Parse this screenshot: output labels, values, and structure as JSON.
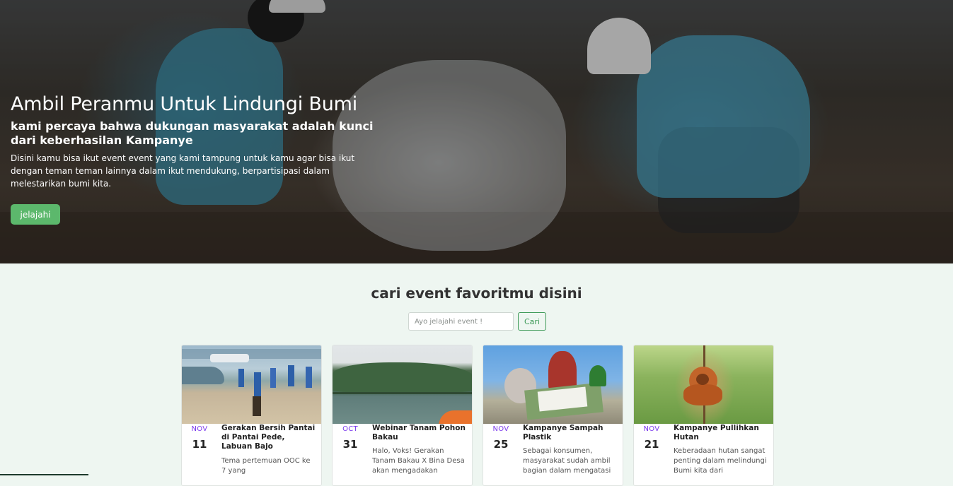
{
  "hero": {
    "title": "Ambil Peranmu Untuk Lindungi Bumi",
    "subtitle": "kami percaya bahwa dukungan masyarakat adalah kunci dari keberhasilan Kampanye",
    "description": "Disini kamu bisa ikut event event yang kami tampung untuk kamu agar bisa ikut dengan teman teman lainnya dalam ikut mendukung, berpartisipasi dalam melestarikan bumi kita.",
    "button_label": "jelajahi"
  },
  "search": {
    "heading": "cari event favoritmu disini",
    "placeholder": "Ayo jelajahi event !",
    "button_label": "Cari"
  },
  "events": [
    {
      "month": "NOV",
      "day": "11",
      "title": "Gerakan Bersih Pantai di Pantai Pede, Labuan Bajo",
      "description": "Tema pertemuan OOC ke 7 yang"
    },
    {
      "month": "OCT",
      "day": "31",
      "title": "Webinar Tanam Pohon Bakau",
      "description": "Halo, Voks! Gerakan Tanam Bakau X Bina Desa akan mengadakan"
    },
    {
      "month": "NOV",
      "day": "25",
      "title": "Kampanye Sampah Plastik",
      "description": "Sebagai konsumen, masyarakat sudah ambil bagian dalam mengatasi"
    },
    {
      "month": "NOV",
      "day": "21",
      "title": "Kampanye Pullihkan Hutan",
      "description": "Keberadaan hutan sangat penting dalam melindungi Bumi kita dari"
    }
  ],
  "colors": {
    "accent_green": "#5cb86c",
    "month_purple": "#7c3aed",
    "section_bg": "#eef6f1"
  }
}
